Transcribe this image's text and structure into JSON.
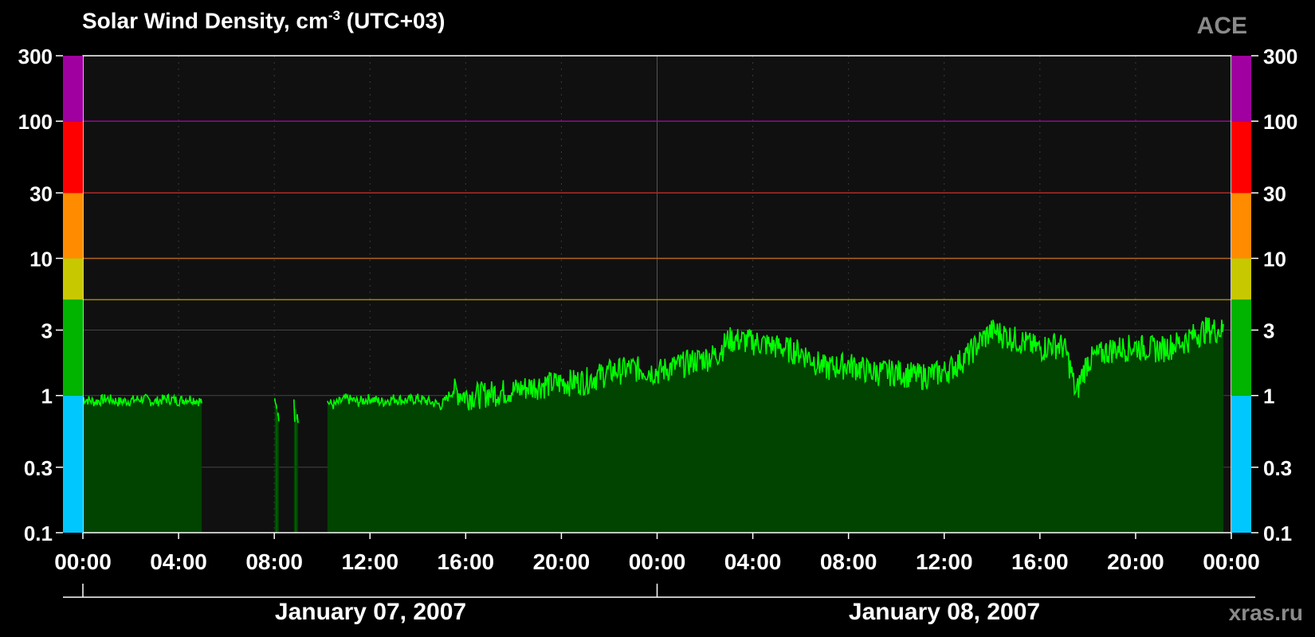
{
  "title": {
    "prefix": "Solar Wind Density, cm",
    "exponent": "-3",
    "suffix": " (UTC+03)"
  },
  "source_label": "ACE",
  "credit": "xras.ru",
  "dates": [
    "January 07, 2007",
    "January 08, 2007"
  ],
  "chart_data": {
    "type": "area",
    "y_scale": "log",
    "ylim": [
      0.1,
      300
    ],
    "y_ticks": [
      {
        "value": 300,
        "label": "300"
      },
      {
        "value": 100,
        "label": "100"
      },
      {
        "value": 30,
        "label": "30"
      },
      {
        "value": 10,
        "label": "10"
      },
      {
        "value": 3,
        "label": "3"
      },
      {
        "value": 1,
        "label": "1"
      },
      {
        "value": 0.3,
        "label": "0.3"
      },
      {
        "value": 0.1,
        "label": "0.1"
      }
    ],
    "x_ticks": [
      "00:00",
      "04:00",
      "08:00",
      "12:00",
      "16:00",
      "20:00",
      "00:00",
      "04:00",
      "08:00",
      "12:00",
      "16:00",
      "20:00",
      "00:00"
    ],
    "x_range_hours": [
      0,
      48
    ],
    "threshold_bands": [
      {
        "from": 0.1,
        "to": 1,
        "color": "#00c8ff"
      },
      {
        "from": 1,
        "to": 5,
        "color": "#00b400"
      },
      {
        "from": 5,
        "to": 10,
        "color": "#c8c800"
      },
      {
        "from": 10,
        "to": 30,
        "color": "#ff8c00"
      },
      {
        "from": 30,
        "to": 100,
        "color": "#ff0000"
      },
      {
        "from": 100,
        "to": 300,
        "color": "#a000a0"
      }
    ],
    "threshold_lines": [
      {
        "value": 100,
        "color": "#a000a0"
      },
      {
        "value": 30,
        "color": "#b42828"
      },
      {
        "value": 10,
        "color": "#b4641e"
      },
      {
        "value": 5,
        "color": "#a08c00"
      }
    ],
    "series": [
      {
        "line_color": "#00ff00",
        "fill_color": "#004400",
        "gaps": [
          [
            5.0,
            8.0
          ],
          [
            8.2,
            8.8
          ],
          [
            9.0,
            10.2
          ]
        ],
        "x": [
          0.0,
          0.5,
          1.0,
          1.5,
          2.0,
          2.5,
          3.0,
          3.5,
          4.0,
          4.5,
          5.0,
          8.0,
          8.2,
          8.8,
          9.0,
          10.2,
          10.5,
          11.0,
          11.5,
          12.0,
          12.5,
          13.0,
          13.5,
          14.0,
          14.5,
          15.0,
          15.5,
          16.0,
          17.0,
          18.0,
          19.0,
          20.0,
          21.0,
          22.0,
          23.0,
          24.0,
          25.0,
          26.0,
          26.5,
          27.0,
          28.0,
          29.0,
          30.0,
          31.0,
          32.0,
          33.0,
          34.0,
          35.0,
          36.0,
          36.5,
          37.0,
          38.0,
          39.0,
          40.0,
          40.5,
          41.0,
          41.5,
          42.0,
          43.0,
          44.0,
          45.0,
          46.0,
          47.0,
          47.7
        ],
        "y": [
          0.95,
          0.9,
          0.95,
          0.9,
          0.92,
          0.95,
          0.9,
          0.95,
          0.92,
          0.95,
          0.9,
          0.8,
          0.8,
          0.8,
          0.8,
          0.9,
          0.85,
          0.95,
          0.9,
          0.95,
          0.9,
          0.95,
          0.92,
          0.95,
          0.9,
          0.85,
          1.1,
          1.0,
          1.05,
          1.1,
          1.2,
          1.25,
          1.3,
          1.5,
          1.6,
          1.5,
          1.7,
          1.9,
          2.0,
          2.6,
          2.5,
          2.3,
          2.1,
          1.6,
          1.7,
          1.5,
          1.5,
          1.4,
          1.5,
          1.7,
          2.0,
          3.0,
          2.6,
          2.2,
          2.4,
          2.3,
          1.0,
          1.8,
          2.2,
          2.3,
          2.2,
          2.5,
          3.1,
          3.0
        ]
      }
    ]
  }
}
